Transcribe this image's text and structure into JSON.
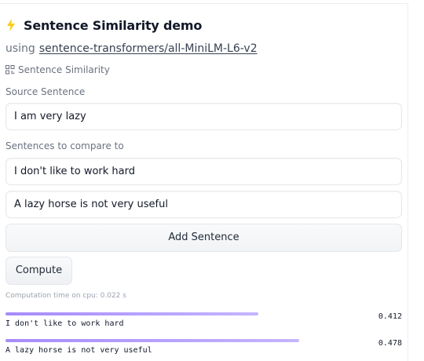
{
  "header": {
    "title": "Sentence Similarity demo",
    "icon": "lightning-bolt-icon",
    "icon_color": "#facc15"
  },
  "model": {
    "prefix": "using",
    "name": "sentence-transformers/all-MiniLM-L6-v2"
  },
  "task": {
    "icon": "task-grid-icon",
    "label": "Sentence Similarity"
  },
  "source": {
    "label": "Source Sentence",
    "value": "I am very lazy"
  },
  "compare": {
    "label": "Sentences to compare to",
    "sentences": [
      "I don't like to work hard",
      "A lazy horse is not very useful"
    ]
  },
  "buttons": {
    "add_sentence": "Add Sentence",
    "compute": "Compute"
  },
  "timing": "Computation time on cpu: 0.022 s",
  "results": [
    {
      "label": "I don't like to work hard",
      "score": 0.412
    },
    {
      "label": "A lazy horse is not very useful",
      "score": 0.478
    }
  ],
  "colors": {
    "bar_start": "#a78bfa",
    "bar_end": "#c4b5fd"
  }
}
